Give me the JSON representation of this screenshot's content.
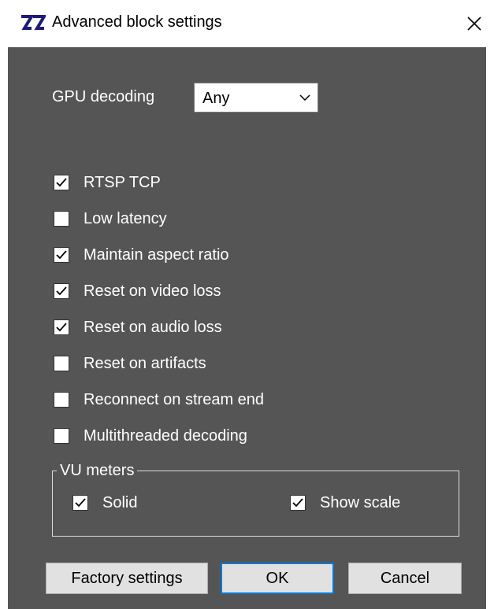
{
  "window": {
    "title": "Advanced block settings",
    "app_icon": "zz-logo-icon",
    "close_icon": "close-icon",
    "close_glyph": "✕",
    "client_background": "#555555"
  },
  "gpu": {
    "label": "GPU decoding",
    "selected": "Any"
  },
  "options": [
    {
      "label": "RTSP TCP",
      "checked": true
    },
    {
      "label": "Low latency",
      "checked": false
    },
    {
      "label": "Maintain aspect ratio",
      "checked": true
    },
    {
      "label": "Reset on video loss",
      "checked": true
    },
    {
      "label": "Reset on audio loss",
      "checked": true
    },
    {
      "label": "Reset on artifacts",
      "checked": false
    },
    {
      "label": "Reconnect on stream end",
      "checked": false
    },
    {
      "label": "Multithreaded decoding",
      "checked": false
    }
  ],
  "vu_meters": {
    "legend": "VU meters",
    "solid": {
      "label": "Solid",
      "checked": true
    },
    "show_scale": {
      "label": "Show scale",
      "checked": true
    }
  },
  "buttons": {
    "factory": "Factory settings",
    "ok": "OK",
    "cancel": "Cancel"
  }
}
